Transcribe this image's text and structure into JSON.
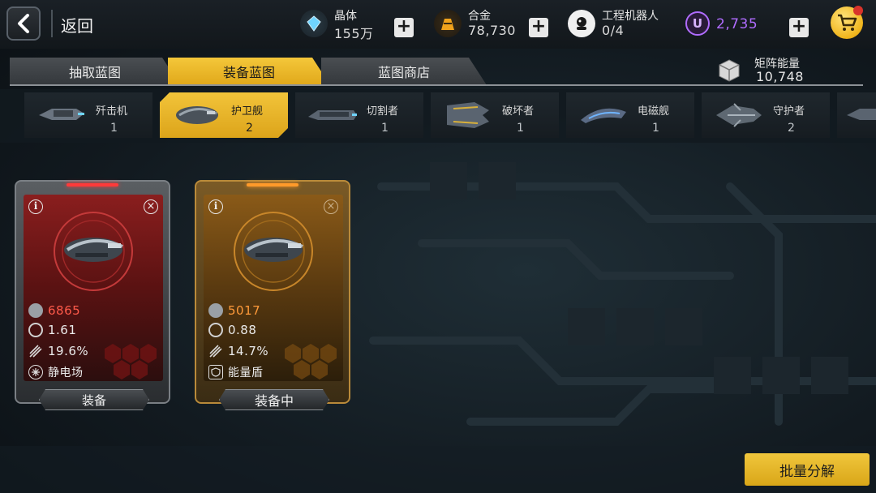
{
  "header": {
    "back_label": "返回",
    "resources": [
      {
        "name": "crystal",
        "label": "晶体",
        "value": "155万",
        "icon": "crystal-icon",
        "color": "#6fd4ff"
      },
      {
        "name": "alloy",
        "label": "合金",
        "value": "78,730",
        "icon": "alloy-icon",
        "color": "#f0a21c"
      },
      {
        "name": "robot",
        "label": "工程机器人",
        "value": "0/4",
        "icon": "robot-icon",
        "color": "#e6e6e6"
      },
      {
        "name": "premium",
        "label": "",
        "value": "2,735",
        "icon": "u-coin-icon",
        "color": "#b06cff"
      }
    ],
    "plus_symbol": "+",
    "cart_icon": "shopping-cart-icon"
  },
  "tabs": [
    {
      "label": "抽取蓝图",
      "active": false
    },
    {
      "label": "装备蓝图",
      "active": true
    },
    {
      "label": "蓝图商店",
      "active": false
    }
  ],
  "matrix_energy": {
    "label": "矩阵能量",
    "value": "10,748"
  },
  "ships": [
    {
      "name": "歼击机",
      "count": "1",
      "active": false
    },
    {
      "name": "护卫舰",
      "count": "2",
      "active": true
    },
    {
      "name": "切割者",
      "count": "1",
      "active": false
    },
    {
      "name": "破坏者",
      "count": "1",
      "active": false
    },
    {
      "name": "电磁舰",
      "count": "1",
      "active": false
    },
    {
      "name": "守护者",
      "count": "2",
      "active": false
    }
  ],
  "cards": [
    {
      "theme": "red",
      "power": "6865",
      "speed": "1.61",
      "rate": "19.6%",
      "skill": "静电场",
      "button": "装备",
      "equipped": false
    },
    {
      "theme": "gold",
      "power": "5017",
      "speed": "0.88",
      "rate": "14.7%",
      "skill": "能量盾",
      "button": "装备中",
      "equipped": true
    }
  ],
  "info_symbol": "i",
  "close_symbol": "×",
  "batch_button": "批量分解",
  "colors": {
    "accent": "#e8b424",
    "red_card": "#8a1e1e",
    "gold_card": "#8a5a18"
  }
}
